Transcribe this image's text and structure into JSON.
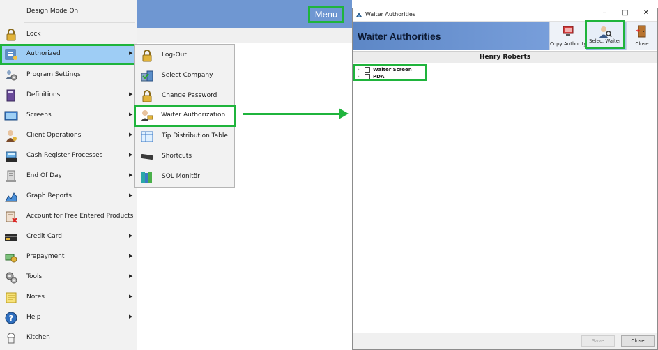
{
  "app": {
    "menu_label": "Menu"
  },
  "main_menu": {
    "items": [
      {
        "label": "Design Mode On",
        "icon": "none",
        "arrow": false
      },
      {
        "label": "Lock",
        "icon": "lock-icon",
        "arrow": false
      },
      {
        "label": "Authorized",
        "icon": "authorized-icon",
        "arrow": true,
        "selected": true
      },
      {
        "label": "Program Settings",
        "icon": "users-settings-icon",
        "arrow": false
      },
      {
        "label": "Definitions",
        "icon": "book-icon",
        "arrow": true
      },
      {
        "label": "Screens",
        "icon": "screens-icon",
        "arrow": true
      },
      {
        "label": "Client Operations",
        "icon": "client-icon",
        "arrow": true
      },
      {
        "label": "Cash Register Processes",
        "icon": "cash-register-icon",
        "arrow": true
      },
      {
        "label": "End Of Day",
        "icon": "end-of-day-icon",
        "arrow": true
      },
      {
        "label": "Graph Reports",
        "icon": "chart-icon",
        "arrow": true
      },
      {
        "label": "Account for Free Entered Products",
        "icon": "free-products-icon",
        "arrow": false
      },
      {
        "label": "Credit Card",
        "icon": "credit-card-icon",
        "arrow": true
      },
      {
        "label": "Prepayment",
        "icon": "prepayment-icon",
        "arrow": true
      },
      {
        "label": "Tools",
        "icon": "gears-icon",
        "arrow": true
      },
      {
        "label": "Notes",
        "icon": "notes-icon",
        "arrow": true
      },
      {
        "label": "Help",
        "icon": "help-icon",
        "arrow": true
      },
      {
        "label": "Kitchen",
        "icon": "kitchen-icon",
        "arrow": false
      }
    ]
  },
  "sub_menu": {
    "items": [
      {
        "label": "Log-Out",
        "icon": "lock-icon"
      },
      {
        "label": "Select Company",
        "icon": "company-icon"
      },
      {
        "label": "Change Password",
        "icon": "lock-icon"
      },
      {
        "label": "Waiter Authorization",
        "icon": "waiter-icon",
        "selected": true
      },
      {
        "label": "Tip Distribution Table",
        "icon": "table-icon"
      },
      {
        "label": "Shortcuts",
        "icon": "keyboard-icon"
      },
      {
        "label": "SQL Monitör",
        "icon": "books-icon"
      }
    ]
  },
  "dialog": {
    "window_title": "Waiter Authorities",
    "header_title": "Waiter Authorities",
    "toolbar": {
      "copy_authority": "Copy Authority",
      "select_waiter": "Selec. Waiter",
      "close": "Close"
    },
    "selected_user": "Henry Roberts",
    "tree": [
      {
        "label": "Waiter Screen"
      },
      {
        "label": "PDA"
      }
    ],
    "footer": {
      "save": "Save",
      "close": "Close"
    }
  },
  "colors": {
    "highlight": "#1fb43c",
    "header_blue": "#6f97d2",
    "selection_blue": "#9ecdf5"
  }
}
